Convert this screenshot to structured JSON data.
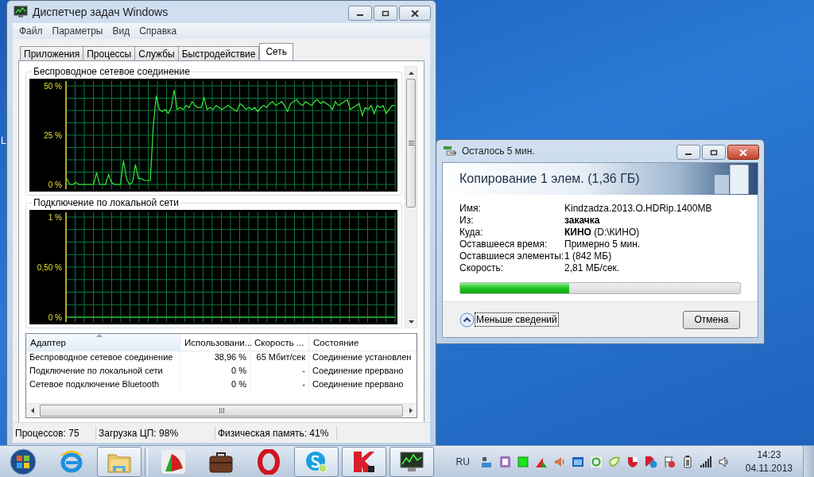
{
  "desktop": {
    "icon_label": "L"
  },
  "task_manager": {
    "title": "Диспетчер задач Windows",
    "menu": [
      "Файл",
      "Параметры",
      "Вид",
      "Справка"
    ],
    "tabs": [
      {
        "label": "Приложения",
        "selected": false
      },
      {
        "label": "Процессы",
        "selected": false
      },
      {
        "label": "Службы",
        "selected": false
      },
      {
        "label": "Быстродействие",
        "selected": false
      },
      {
        "label": "Сеть",
        "selected": true
      }
    ],
    "graphs": [
      {
        "chart_data": {
          "type": "line",
          "title": "Беспроводное сетевое соединение",
          "grid": true,
          "ylim": [
            0,
            50
          ],
          "yticks": [
            {
              "value": 0,
              "label": "0 %"
            },
            {
              "value": 25,
              "label": "25 %"
            },
            {
              "value": 50,
              "label": "50 %"
            }
          ],
          "series": [
            {
              "color": "#33ee33",
              "values": [
                3,
                0,
                0,
                1,
                0,
                0,
                0,
                0,
                0,
                0,
                6,
                0,
                0,
                0,
                5,
                1,
                0,
                0,
                0,
                12,
                3,
                0,
                1,
                10,
                3,
                3,
                2,
                2,
                2,
                30,
                45,
                38,
                37,
                38,
                36,
                39,
                48,
                38,
                39,
                38,
                40,
                39,
                42,
                40,
                39,
                39,
                44,
                38,
                39,
                38,
                40,
                39,
                38,
                39,
                40,
                39,
                38,
                37,
                41,
                40,
                38,
                39,
                38,
                39,
                37,
                39,
                40,
                39,
                41,
                42,
                40,
                41,
                42,
                40,
                37,
                41,
                42,
                43,
                41,
                40,
                42,
                41,
                40,
                42,
                43,
                41,
                42,
                41,
                40,
                38,
                42,
                40,
                41,
                42,
                43,
                38,
                39,
                40,
                41,
                35,
                39,
                38,
                40,
                36,
                40,
                39,
                40,
                36,
                38,
                40,
                40
              ]
            }
          ]
        }
      },
      {
        "chart_data": {
          "type": "line",
          "title": "Подключение по локальной сети",
          "grid": true,
          "ylim": [
            0,
            1
          ],
          "yticks": [
            {
              "value": 0,
              "label": "0 %"
            },
            {
              "value": 0.5,
              "label": "0,50 %"
            },
            {
              "value": 1,
              "label": "1 %"
            }
          ],
          "series": [
            {
              "color": "#33ee33",
              "values": [
                0,
                0,
                0,
                0,
                0,
                0,
                0,
                0,
                0,
                0,
                0,
                0,
                0,
                0,
                0,
                0,
                0,
                0,
                0,
                0
              ]
            }
          ]
        }
      }
    ],
    "table": {
      "columns": [
        {
          "label": "Адаптер",
          "sorted": true
        },
        {
          "label": "Использовани...",
          "sorted": false
        },
        {
          "label": "Скорость ...",
          "sorted": false
        },
        {
          "label": "Состояние",
          "sorted": false
        }
      ],
      "rows": [
        [
          "Беспроводное сетевое соединение",
          "38,96 %",
          "65 Мбит/сек",
          "Соединение установлен"
        ],
        [
          "Подключение по локальной сети",
          "0 %",
          "-",
          "Соединение прервано"
        ],
        [
          "Сетевое подключение Bluetooth",
          "0 %",
          "-",
          "Соединение прервано"
        ]
      ]
    },
    "status_bar": [
      "Процессов: 75",
      "Загрузка ЦП: 98%",
      "Физическая память: 41%"
    ]
  },
  "copy_dialog": {
    "title": "Осталось 5 мин.",
    "heading": "Копирование 1 элем. (1,36 ГБ)",
    "details": [
      {
        "label": "Имя:",
        "value": "Kindzadza.2013.O.HDRip.1400MB",
        "bold": false
      },
      {
        "label": "Из:",
        "value": "закачка",
        "bold": true
      },
      {
        "label": "Куда:",
        "value": "**КИНО** (D:\\КИНО)",
        "bold": false
      },
      {
        "label": "Оставшееся время:",
        "value": "Примерно 5 мин.",
        "bold": false
      },
      {
        "label": "Оставшиеся элементы:",
        "value": "1 (842 МБ)",
        "bold": false
      },
      {
        "label": "Скорость:",
        "value": "2,81 МБ/сек.",
        "bold": false
      }
    ],
    "progress": {
      "level": 0.39
    },
    "toggle": "Меньше сведений",
    "cancel": "Отмена"
  },
  "taskbar": {
    "apps": [
      {
        "kind": "ie",
        "running": false
      },
      {
        "kind": "explorer",
        "running": true
      },
      {
        "kind": "fan",
        "running": false
      },
      {
        "kind": "suitcase",
        "running": false
      },
      {
        "kind": "opera",
        "running": false
      },
      {
        "kind": "skype",
        "running": true
      },
      {
        "kind": "kaspersky",
        "running": true
      },
      {
        "kind": "taskmgr",
        "running": true
      }
    ],
    "language": "RU",
    "clock": "14:23",
    "date": "04.11.2013"
  }
}
